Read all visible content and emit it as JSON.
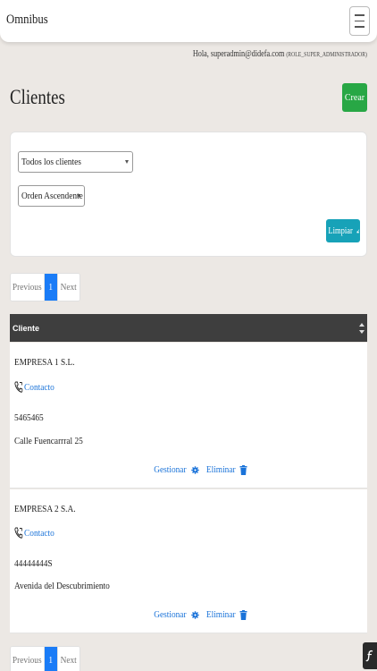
{
  "app": {
    "brand": "Omnibus"
  },
  "user": {
    "greeting": "Hola, superadmin@didefa.com",
    "role": "(ROLE_SUPER_ADMINISTRADOR)"
  },
  "page": {
    "title": "Clientes",
    "create_label": "Crear"
  },
  "filters": {
    "clients_selected": "Todos los clientes",
    "order_selected": "Orden Ascendente",
    "clear_label": "Limpiar"
  },
  "pagination": {
    "previous": "Previous",
    "current": "1",
    "next": "Next"
  },
  "table": {
    "header": "Cliente",
    "rows": [
      {
        "name": "EMPRESA 1 S.L.",
        "contact_label": "Contacto",
        "phone": "5465465",
        "address": "Calle Fuencarrral 25",
        "manage_label": "Gestionar",
        "delete_label": "Eliminar"
      },
      {
        "name": "EMPRESA 2 S.A.",
        "contact_label": "Contacto",
        "phone": "44444444S",
        "address": "Avenida del Descubrimiento",
        "manage_label": "Gestionar",
        "delete_label": "Eliminar"
      }
    ]
  },
  "colors": {
    "background": "#ece8e4",
    "create_button": "#28a745",
    "clear_button": "#17a2b8",
    "active_page": "#1a7cf7",
    "link": "#1a73d9",
    "table_header": "#3e3e3e"
  },
  "icons": {
    "menu": "hamburger-icon",
    "clear": "broom-icon",
    "contact": "phone-icon",
    "manage": "gear-icon",
    "delete": "trash-icon",
    "sort": "sort-icon",
    "corner": "symfony-icon"
  }
}
